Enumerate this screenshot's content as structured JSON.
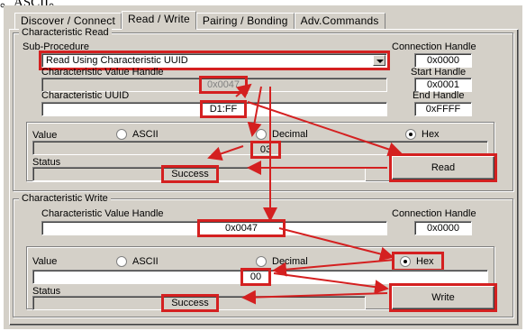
{
  "caption": "。ASCII。",
  "tabs": [
    {
      "label": "Discover / Connect"
    },
    {
      "label": "Read / Write"
    },
    {
      "label": "Pairing / Bonding"
    },
    {
      "label": "Adv.Commands"
    }
  ],
  "characteristic_read": {
    "title": "Characteristic Read",
    "sub_procedure_label": "Sub-Procedure",
    "sub_procedure_value": "Read Using Characteristic UUID",
    "connection_handle_label": "Connection Handle",
    "connection_handle_value": "0x0000",
    "value_handle_label": "Characteristic Value Handle",
    "value_handle_value": "0x0047",
    "start_handle_label": "Start Handle",
    "start_handle_value": "0x0001",
    "uuid_label": "Characteristic UUID",
    "uuid_value": "D1:FF",
    "end_handle_label": "End Handle",
    "end_handle_value": "0xFFFF",
    "value_label": "Value",
    "format_options": [
      "ASCII",
      "Decimal",
      "Hex"
    ],
    "selected_format": "Hex",
    "value": "03",
    "status_label": "Status",
    "status_value": "Success",
    "read_button": "Read"
  },
  "characteristic_write": {
    "title": "Characteristic Write",
    "value_handle_label": "Characteristic Value Handle",
    "value_handle_value": "0x0047",
    "connection_handle_label": "Connection Handle",
    "connection_handle_value": "0x0000",
    "value_label": "Value",
    "format_options": [
      "ASCII",
      "Decimal",
      "Hex"
    ],
    "selected_format": "Hex",
    "value": "00",
    "status_label": "Status",
    "status_value": "Success",
    "write_button": "Write"
  },
  "colors": {
    "window_bg": "#d4d0c8",
    "highlight_red": "#d42020"
  }
}
